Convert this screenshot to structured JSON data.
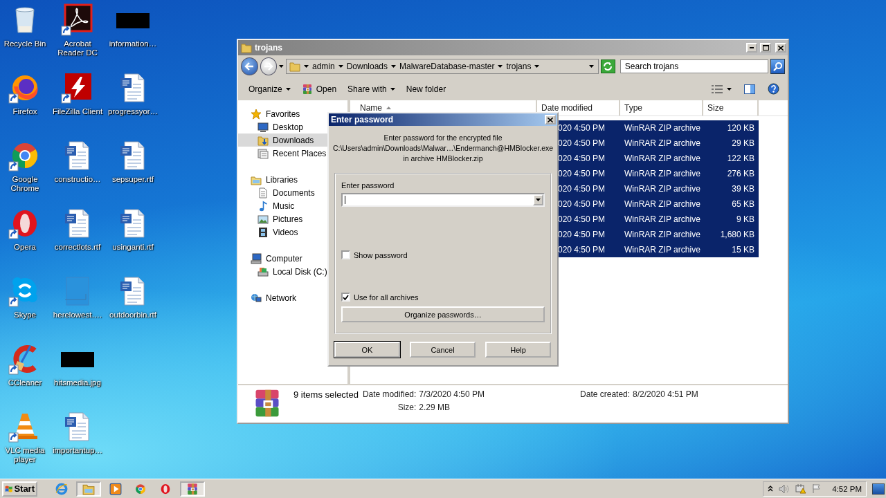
{
  "desktop": {
    "icons": [
      {
        "label": "Recycle Bin",
        "kind": "recycle-bin",
        "shortcut": false
      },
      {
        "label": "Firefox",
        "kind": "firefox",
        "shortcut": true
      },
      {
        "label": "Google Chrome",
        "kind": "chrome",
        "shortcut": true
      },
      {
        "label": "Opera",
        "kind": "opera",
        "shortcut": true
      },
      {
        "label": "Skype",
        "kind": "skype",
        "shortcut": true
      },
      {
        "label": "CCleaner",
        "kind": "ccleaner",
        "shortcut": true
      },
      {
        "label": "VLC media player",
        "kind": "vlc",
        "shortcut": true
      },
      {
        "label": "Acrobat Reader DC",
        "kind": "pdf",
        "shortcut": true
      },
      {
        "label": "FileZilla Client",
        "kind": "filezilla",
        "shortcut": true
      },
      {
        "label": "constructio…",
        "kind": "word",
        "shortcut": false
      },
      {
        "label": "correctlots.rtf",
        "kind": "word",
        "shortcut": false
      },
      {
        "label": "herelowest….",
        "kind": "blank",
        "shortcut": false
      },
      {
        "label": "hitsmedia.jpg",
        "kind": "redacted",
        "shortcut": false
      },
      {
        "label": "importantup…",
        "kind": "word",
        "shortcut": false
      },
      {
        "label": "information…",
        "kind": "redacted",
        "shortcut": false
      },
      {
        "label": "progressyor…",
        "kind": "word",
        "shortcut": false
      },
      {
        "label": "sepsuper.rtf",
        "kind": "word",
        "shortcut": false
      },
      {
        "label": "usinganti.rtf",
        "kind": "word",
        "shortcut": false
      },
      {
        "label": "outdoorbin.rtf",
        "kind": "word",
        "shortcut": false
      }
    ]
  },
  "explorer": {
    "title": "trojans",
    "breadcrumbs": [
      "admin",
      "Downloads",
      "MalwareDatabase-master",
      "trojans"
    ],
    "search": {
      "placeholder": "Search trojans"
    },
    "toolbar": [
      {
        "label": "Organize",
        "kind": "menu"
      },
      {
        "label": "Open",
        "kind": "open"
      },
      {
        "label": "Share with",
        "kind": "menu"
      },
      {
        "label": "New folder",
        "kind": "plain"
      }
    ],
    "navigation": [
      {
        "label": "Favorites",
        "kind": "star",
        "selected": false,
        "children": [
          {
            "label": "Desktop",
            "kind": "desktop",
            "selected": false
          },
          {
            "label": "Downloads",
            "kind": "downloads",
            "selected": true
          },
          {
            "label": "Recent Places",
            "kind": "recent",
            "selected": false
          }
        ]
      },
      {
        "label": "Libraries",
        "kind": "library",
        "selected": false,
        "children": [
          {
            "label": "Documents",
            "kind": "documents",
            "selected": false
          },
          {
            "label": "Music",
            "kind": "music",
            "selected": false
          },
          {
            "label": "Pictures",
            "kind": "pictures",
            "selected": false
          },
          {
            "label": "Videos",
            "kind": "videos",
            "selected": false
          }
        ]
      },
      {
        "label": "Computer",
        "kind": "computer",
        "selected": false,
        "children": [
          {
            "label": "Local Disk (C:)",
            "kind": "disk",
            "selected": false
          }
        ]
      },
      {
        "label": "Network",
        "kind": "network",
        "selected": false
      }
    ],
    "columns": [
      {
        "label": "Name",
        "sorted": true
      },
      {
        "label": "Date modified",
        "sorted": false
      },
      {
        "label": "Type",
        "sorted": false
      },
      {
        "label": "Size",
        "sorted": false
      }
    ],
    "rows": [
      {
        "date_modified": "020 4:50 PM",
        "type": "WinRAR ZIP archive",
        "size": "120 KB",
        "selected": true
      },
      {
        "date_modified": "020 4:50 PM",
        "type": "WinRAR ZIP archive",
        "size": "29 KB",
        "selected": true
      },
      {
        "date_modified": "020 4:50 PM",
        "type": "WinRAR ZIP archive",
        "size": "122 KB",
        "selected": true
      },
      {
        "date_modified": "020 4:50 PM",
        "type": "WinRAR ZIP archive",
        "size": "276 KB",
        "selected": true
      },
      {
        "date_modified": "020 4:50 PM",
        "type": "WinRAR ZIP archive",
        "size": "39 KB",
        "selected": true
      },
      {
        "date_modified": "020 4:50 PM",
        "type": "WinRAR ZIP archive",
        "size": "65 KB",
        "selected": true
      },
      {
        "date_modified": "020 4:50 PM",
        "type": "WinRAR ZIP archive",
        "size": "9 KB",
        "selected": true
      },
      {
        "date_modified": "020 4:50 PM",
        "type": "WinRAR ZIP archive",
        "size": "1,680 KB",
        "selected": true
      },
      {
        "date_modified": "020 4:50 PM",
        "type": "WinRAR ZIP archive",
        "size": "15 KB",
        "selected": true
      }
    ],
    "details": {
      "summary": "9 items selected",
      "fields": [
        {
          "label": "Date modified:",
          "value": "7/3/2020 4:50 PM"
        },
        {
          "label": "Size:",
          "value": "2.29 MB"
        },
        {
          "label": "Date created:",
          "value": "8/2/2020 4:51 PM"
        }
      ]
    }
  },
  "dialog": {
    "title": "Enter password",
    "message": [
      "Enter password for the encrypted file",
      "C:\\Users\\admin\\Downloads\\Malwar…\\Endermanch@HMBlocker.exe",
      "in archive HMBlocker.zip"
    ],
    "password_label": "Enter password",
    "options": [
      {
        "label": "Show password",
        "checked": false
      },
      {
        "label": "Use for all archives",
        "checked": true
      }
    ],
    "organize_button": "Organize passwords…",
    "buttons": [
      {
        "label": "OK",
        "default": true
      },
      {
        "label": "Cancel",
        "default": false
      },
      {
        "label": "Help",
        "default": false
      }
    ]
  },
  "taskbar": {
    "start": "Start",
    "apps": [
      {
        "kind": "ie",
        "active": false
      },
      {
        "kind": "explorer",
        "active": true
      },
      {
        "kind": "media-player",
        "active": false
      },
      {
        "kind": "chrome",
        "active": false
      },
      {
        "kind": "opera",
        "active": false
      },
      {
        "kind": "winrar",
        "active": true
      }
    ],
    "clock": "4:52 PM"
  }
}
